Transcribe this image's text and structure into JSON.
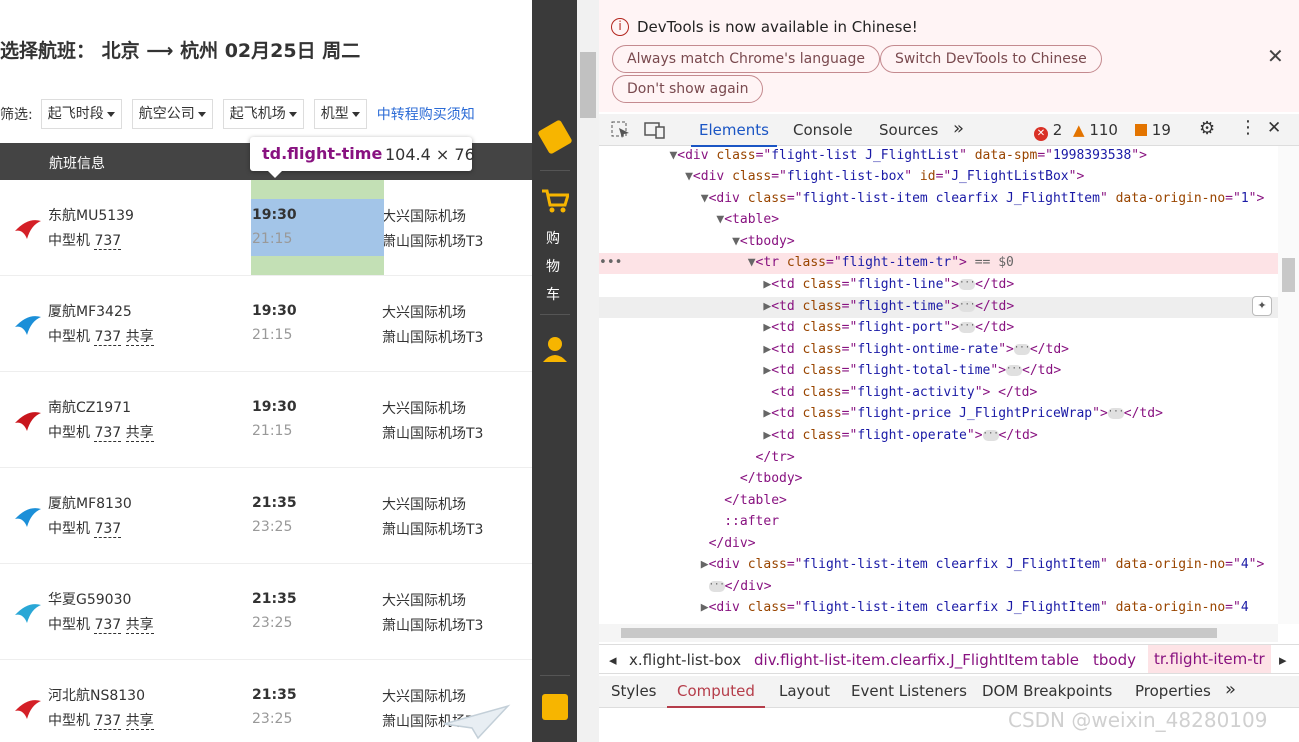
{
  "page": {
    "title": "选择航班：  北京  ⟶  杭州    02月25日 周二",
    "filter_label": "筛选:",
    "filters": [
      "起飞时段",
      "航空公司",
      "起飞机场",
      "机型"
    ],
    "transfer_link": "中转程购买须知",
    "table_header": "航班信息",
    "tooltip": {
      "name": "td.flight-time",
      "size": "104.4 × 76"
    },
    "flights": [
      {
        "airline": "东航MU5139",
        "type": "中型机",
        "model": "737",
        "share": "",
        "dep": "19:30",
        "arr": "21:15",
        "dep_airport": "大兴国际机场",
        "arr_airport": "萧山国际机场T3",
        "logo_color": "#d42027"
      },
      {
        "airline": "厦航MF3425",
        "type": "中型机",
        "model": "737",
        "share": "共享",
        "dep": "19:30",
        "arr": "21:15",
        "dep_airport": "大兴国际机场",
        "arr_airport": "萧山国际机场T3",
        "logo_color": "#1b8fd8"
      },
      {
        "airline": "南航CZ1971",
        "type": "中型机",
        "model": "737",
        "share": "共享",
        "dep": "19:30",
        "arr": "21:15",
        "dep_airport": "大兴国际机场",
        "arr_airport": "萧山国际机场T3",
        "logo_color": "#c8161d"
      },
      {
        "airline": "厦航MF8130",
        "type": "中型机",
        "model": "737",
        "share": "",
        "dep": "21:35",
        "arr": "23:25",
        "dep_airport": "大兴国际机场",
        "arr_airport": "萧山国际机场T3",
        "logo_color": "#1b8fd8"
      },
      {
        "airline": "华夏G59030",
        "type": "中型机",
        "model": "737",
        "share": "共享",
        "dep": "21:35",
        "arr": "23:25",
        "dep_airport": "大兴国际机场",
        "arr_airport": "萧山国际机场T3",
        "logo_color": "#2aa7d6"
      },
      {
        "airline": "河北航NS8130",
        "type": "中型机",
        "model": "737",
        "share": "共享",
        "dep": "21:35",
        "arr": "23:25",
        "dep_airport": "大兴国际机场",
        "arr_airport": "萧山国际机场T3",
        "logo_color": "#d42027"
      }
    ]
  },
  "sidebar": {
    "cart_chars": [
      "购",
      "物",
      "车"
    ]
  },
  "devtools": {
    "banner": {
      "text": "DevTools is now available in Chinese!",
      "btn_match": "Always match Chrome's language",
      "btn_switch": "Switch DevTools to Chinese",
      "btn_dont": "Don't show again"
    },
    "tabs": [
      "Elements",
      "Console",
      "Sources"
    ],
    "more": "»",
    "errors": "2",
    "warnings": "110",
    "issues": "19",
    "breadcrumbs": [
      "x.flight-list-box",
      "div.flight-list-item.clearfix.J_FlightItem",
      "table",
      "tbody",
      "tr.flight-item-tr"
    ],
    "panel_tabs": [
      "Styles",
      "Computed",
      "Layout",
      "Event Listeners",
      "DOM Breakpoints",
      "Properties"
    ],
    "watermark": "CSDN @weixin_48280109"
  }
}
